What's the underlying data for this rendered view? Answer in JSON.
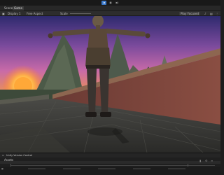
{
  "topbar": {
    "play_icon": "play-icon",
    "pause_icon": "pause-icon",
    "step_icon": "step-icon"
  },
  "tabs": {
    "scene": "Scene",
    "game": "Game"
  },
  "toolbar": {
    "display": "Display 1",
    "aspect": "Free Aspect",
    "scale_label": "Scale",
    "play_focused": "Play Focused"
  },
  "bottom": {
    "version_control": "Unity Version Control",
    "assets_label": "Assets"
  },
  "colors": {
    "accent": "#3a78c9",
    "sunset_top": "#4a3a8c",
    "sunset_mid": "#c86aa8",
    "sun": "#ffb347"
  }
}
